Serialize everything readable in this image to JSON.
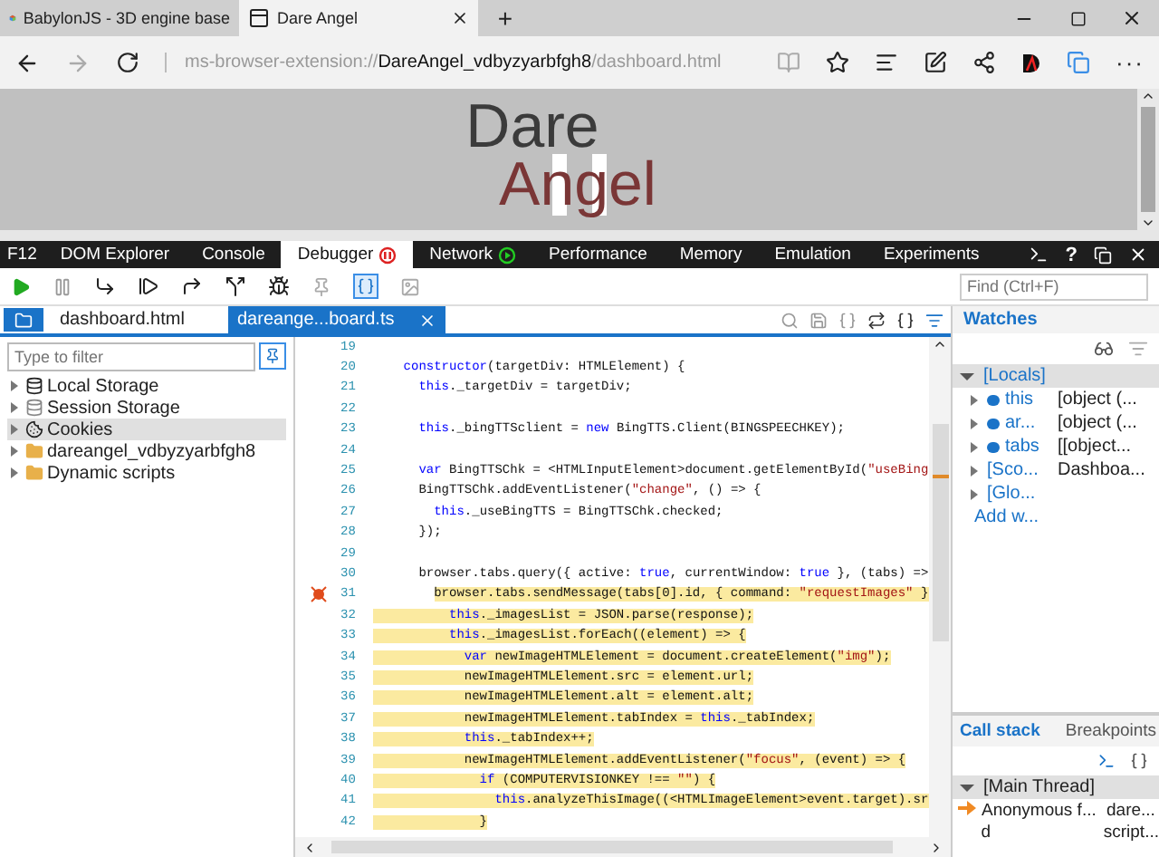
{
  "browser": {
    "tabs": [
      {
        "label": "BabylonJS - 3D engine base",
        "selected": false,
        "kind": "babylon"
      },
      {
        "label": "Dare Angel",
        "selected": true,
        "kind": "page"
      }
    ],
    "new_tab": "+",
    "address": [
      {
        "text": "ms-browser-extension://",
        "emphasis": false
      },
      {
        "text": "DareAngel_vdbyzyarbfgh8",
        "emphasis": true
      },
      {
        "text": "/dashboard.html",
        "emphasis": false
      }
    ],
    "more": "···"
  },
  "page": {
    "logo_top": "Dare",
    "logo_bottom": "Angel"
  },
  "devtools": {
    "tabs": [
      {
        "label": "F12",
        "selected": false,
        "kind": "plain"
      },
      {
        "label": "DOM Explorer",
        "selected": false,
        "kind": "plain"
      },
      {
        "label": "Console",
        "selected": false,
        "kind": "plain"
      },
      {
        "label": "Debugger",
        "selected": true,
        "kind": "paused"
      },
      {
        "label": "Network",
        "selected": false,
        "kind": "running"
      },
      {
        "label": "Performance",
        "selected": false,
        "kind": "plain"
      },
      {
        "label": "Memory",
        "selected": false,
        "kind": "plain"
      },
      {
        "label": "Emulation",
        "selected": false,
        "kind": "plain"
      },
      {
        "label": "Experiments",
        "selected": false,
        "kind": "plain"
      }
    ],
    "help": "?",
    "find": {
      "placeholder": "Find (Ctrl+F)"
    },
    "file_tabs": [
      {
        "label": "dashboard.html",
        "selected": false
      },
      {
        "label": "dareange...board.ts",
        "selected": true
      }
    ],
    "sidebar": {
      "filter": {
        "placeholder": "Type to filter"
      },
      "items": [
        {
          "label": "Local Storage",
          "kind": "storage",
          "selected": false
        },
        {
          "label": "Session Storage",
          "kind": "session",
          "selected": false
        },
        {
          "label": "Cookies",
          "kind": "cookie",
          "selected": true
        },
        {
          "label": "dareangel_vdbyzyarbfgh8",
          "kind": "folder",
          "selected": false
        },
        {
          "label": "Dynamic scripts",
          "kind": "folder",
          "selected": false
        }
      ]
    },
    "code": {
      "lines": [
        {
          "number": "19",
          "breakpoint": false
        },
        {
          "number": "20",
          "highlighted": false,
          "breakpoint": false,
          "tokens": [
            {
              "kind": "kw",
              "text": "    constructor"
            },
            {
              "kind": "txt",
              "text": "(targetDiv: HTMLElement) {"
            }
          ]
        },
        {
          "number": "21",
          "highlighted": false,
          "breakpoint": false,
          "tokens": [
            {
              "kind": "kw",
              "text": "      this"
            },
            {
              "kind": "txt",
              "text": "._targetDiv = targetDiv;"
            }
          ]
        },
        {
          "number": "22",
          "breakpoint": false
        },
        {
          "number": "23",
          "highlighted": false,
          "breakpoint": false,
          "tokens": [
            {
              "kind": "kw",
              "text": "      this"
            },
            {
              "kind": "txt",
              "text": "._bingTTSclient = "
            },
            {
              "kind": "kw",
              "text": "new"
            },
            {
              "kind": "txt",
              "text": " BingTTS.Client(BINGSPEECHKEY);"
            }
          ]
        },
        {
          "number": "24",
          "breakpoint": false
        },
        {
          "number": "25",
          "highlighted": false,
          "breakpoint": false,
          "tokens": [
            {
              "kind": "kw",
              "text": "      var"
            },
            {
              "kind": "txt",
              "text": " BingTTSChk = <HTMLInputElement>document.getElementById("
            },
            {
              "kind": "str",
              "text": "\"useBing"
            }
          ]
        },
        {
          "number": "26",
          "highlighted": false,
          "breakpoint": false,
          "tokens": [
            {
              "kind": "txt",
              "text": "      BingTTSChk.addEventListener("
            },
            {
              "kind": "str",
              "text": "\"change\""
            },
            {
              "kind": "txt",
              "text": ", () => {"
            }
          ]
        },
        {
          "number": "27",
          "highlighted": false,
          "breakpoint": false,
          "tokens": [
            {
              "kind": "kw",
              "text": "        this"
            },
            {
              "kind": "txt",
              "text": "._useBingTTS = BingTTSChk.checked;"
            }
          ]
        },
        {
          "number": "28",
          "highlighted": false,
          "breakpoint": false,
          "tokens": [
            {
              "kind": "txt",
              "text": "      });"
            }
          ]
        },
        {
          "number": "29",
          "breakpoint": false
        },
        {
          "number": "30",
          "highlighted": false,
          "breakpoint": false,
          "tokens": [
            {
              "kind": "txt",
              "text": "      browser.tabs.query({ active: "
            },
            {
              "kind": "kw",
              "text": "true"
            },
            {
              "kind": "txt",
              "text": ", currentWindow: "
            },
            {
              "kind": "kw",
              "text": "true"
            },
            {
              "kind": "txt",
              "text": " }, (tabs) =>"
            }
          ]
        },
        {
          "number": "31",
          "highlighted": true,
          "breakpoint": true,
          "tokens": [
            {
              "kind": "txt",
              "text": "        browser.tabs.sendMessage(tabs[0].id, { command: "
            },
            {
              "kind": "str",
              "text": "\"requestImages\""
            },
            {
              "kind": "txt",
              "text": " }"
            }
          ]
        },
        {
          "number": "32",
          "highlighted": true,
          "breakpoint": false,
          "tokens": [
            {
              "kind": "kw",
              "text": "          this"
            },
            {
              "kind": "txt",
              "text": "._imagesList = JSON.parse(response);"
            }
          ]
        },
        {
          "number": "33",
          "highlighted": true,
          "breakpoint": false,
          "tokens": [
            {
              "kind": "kw",
              "text": "          this"
            },
            {
              "kind": "txt",
              "text": "._imagesList.forEach((element) => {"
            }
          ]
        },
        {
          "number": "34",
          "highlighted": true,
          "breakpoint": false,
          "tokens": [
            {
              "kind": "kw",
              "text": "            var"
            },
            {
              "kind": "txt",
              "text": " newImageHTMLElement = document.createElement("
            },
            {
              "kind": "str",
              "text": "\"img\""
            },
            {
              "kind": "txt",
              "text": ");"
            }
          ]
        },
        {
          "number": "35",
          "highlighted": true,
          "breakpoint": false,
          "tokens": [
            {
              "kind": "txt",
              "text": "            newImageHTMLElement.src = element.url;"
            }
          ]
        },
        {
          "number": "36",
          "highlighted": true,
          "breakpoint": false,
          "tokens": [
            {
              "kind": "txt",
              "text": "            newImageHTMLElement.alt = element.alt;"
            }
          ]
        },
        {
          "number": "37",
          "highlighted": true,
          "breakpoint": false,
          "tokens": [
            {
              "kind": "txt",
              "text": "            newImageHTMLElement.tabIndex = "
            },
            {
              "kind": "kw",
              "text": "this"
            },
            {
              "kind": "txt",
              "text": "._tabIndex;"
            }
          ]
        },
        {
          "number": "38",
          "highlighted": true,
          "breakpoint": false,
          "tokens": [
            {
              "kind": "kw",
              "text": "            this"
            },
            {
              "kind": "txt",
              "text": "._tabIndex++;"
            }
          ]
        },
        {
          "number": "39",
          "highlighted": true,
          "breakpoint": false,
          "tokens": [
            {
              "kind": "txt",
              "text": "            newImageHTMLElement.addEventListener("
            },
            {
              "kind": "str",
              "text": "\"focus\""
            },
            {
              "kind": "txt",
              "text": ", (event) => {"
            }
          ]
        },
        {
          "number": "40",
          "highlighted": true,
          "breakpoint": false,
          "tokens": [
            {
              "kind": "kw",
              "text": "              if"
            },
            {
              "kind": "txt",
              "text": " (COMPUTERVISIONKEY !== "
            },
            {
              "kind": "str",
              "text": "\"\""
            },
            {
              "kind": "txt",
              "text": ") {"
            }
          ]
        },
        {
          "number": "41",
          "highlighted": true,
          "breakpoint": false,
          "tokens": [
            {
              "kind": "kw",
              "text": "                this"
            },
            {
              "kind": "txt",
              "text": ".analyzeThisImage((<HTMLImageElement>event.target).sr"
            }
          ]
        },
        {
          "number": "42",
          "highlighted": true,
          "breakpoint": false,
          "tokens": [
            {
              "kind": "txt",
              "text": "              }"
            }
          ]
        }
      ]
    },
    "watches": {
      "title": "Watches",
      "items": [
        {
          "name": "[Locals]",
          "expanded": true,
          "kind": "group",
          "children": [
            {
              "name": "this",
              "value": "[object (...",
              "expanded": false,
              "kind": "object"
            },
            {
              "name": "ar...",
              "value": "[object (...",
              "expanded": false,
              "kind": "object"
            },
            {
              "name": "tabs",
              "value": "[[object...",
              "expanded": false,
              "kind": "object"
            },
            {
              "name": "[Sco...",
              "value": "Dashboa...",
              "expanded": false,
              "kind": "scope"
            },
            {
              "name": "[Glo...",
              "expanded": false,
              "kind": "scope"
            }
          ]
        }
      ],
      "add": "Add w..."
    },
    "callstack": {
      "tabs": [
        {
          "label": "Call stack",
          "selected": true
        },
        {
          "label": "Breakpoints",
          "selected": false
        }
      ],
      "thread": "[Main Thread]",
      "frames": [
        {
          "name": "Anonymous f...",
          "location": "dare...",
          "current": true
        },
        {
          "name": "d",
          "location": "script...",
          "current": false
        }
      ]
    }
  }
}
